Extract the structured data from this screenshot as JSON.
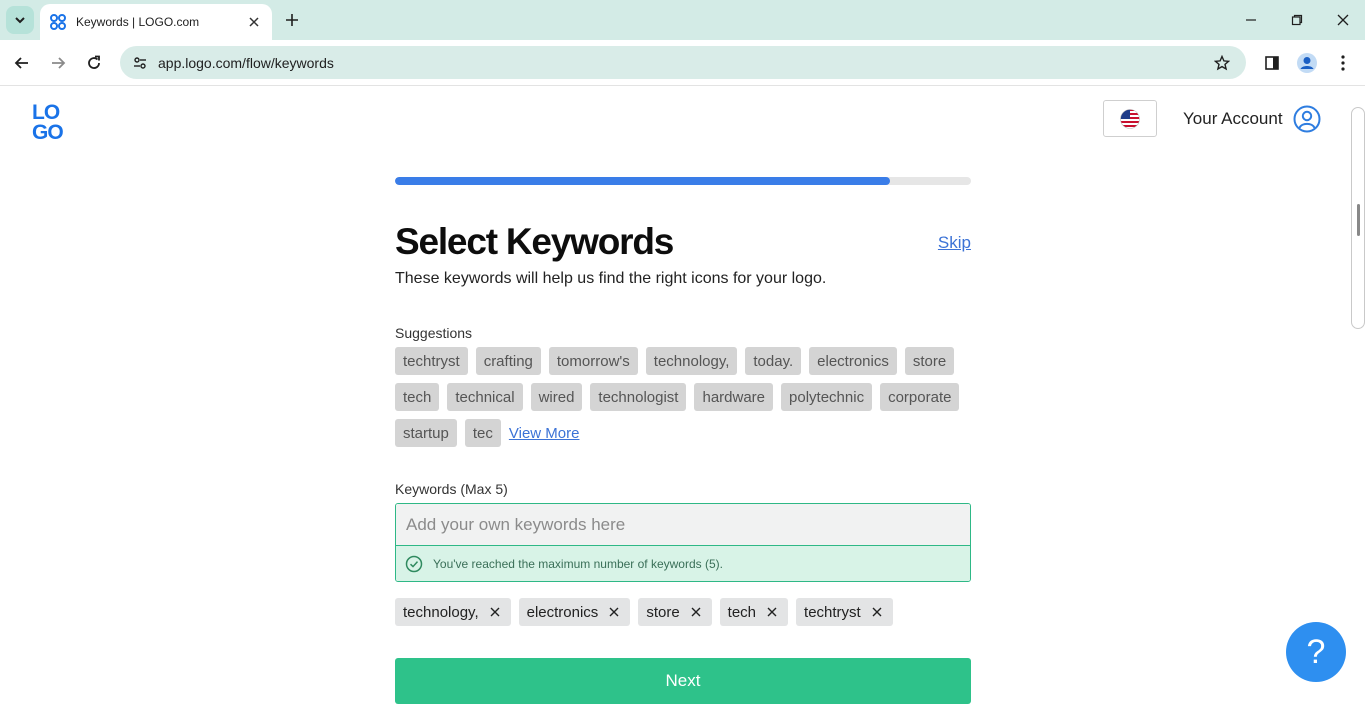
{
  "browser": {
    "tab_title": "Keywords | LOGO.com",
    "url": "app.logo.com/flow/keywords"
  },
  "header": {
    "logo_text": "LOGO",
    "account_label": "Your Account"
  },
  "main": {
    "progress_fraction": 0.86,
    "title": "Select Keywords",
    "skip_label": "Skip",
    "subtitle": "These keywords will help us find the right icons for your logo.",
    "suggestions_label": "Suggestions",
    "suggestions": [
      "techtryst",
      "crafting",
      "tomorrow's",
      "technology,",
      "today.",
      "electronics",
      "store",
      "tech",
      "technical",
      "wired",
      "technologist",
      "hardware",
      "polytechnic",
      "corporate",
      "startup",
      "tec"
    ],
    "view_more_label": "View More",
    "keywords_label": "Keywords (Max 5)",
    "keywords_placeholder": "Add your own keywords here",
    "max_message": "You've reached the maximum number of keywords (5).",
    "selected_keywords": [
      "technology,",
      "electronics",
      "store",
      "tech",
      "techtryst"
    ],
    "next_label": "Next",
    "help_label": "?"
  },
  "colors": {
    "accent_green": "#2ec28a",
    "progress_blue": "#3a7de8",
    "link_blue": "#3b72d6"
  }
}
